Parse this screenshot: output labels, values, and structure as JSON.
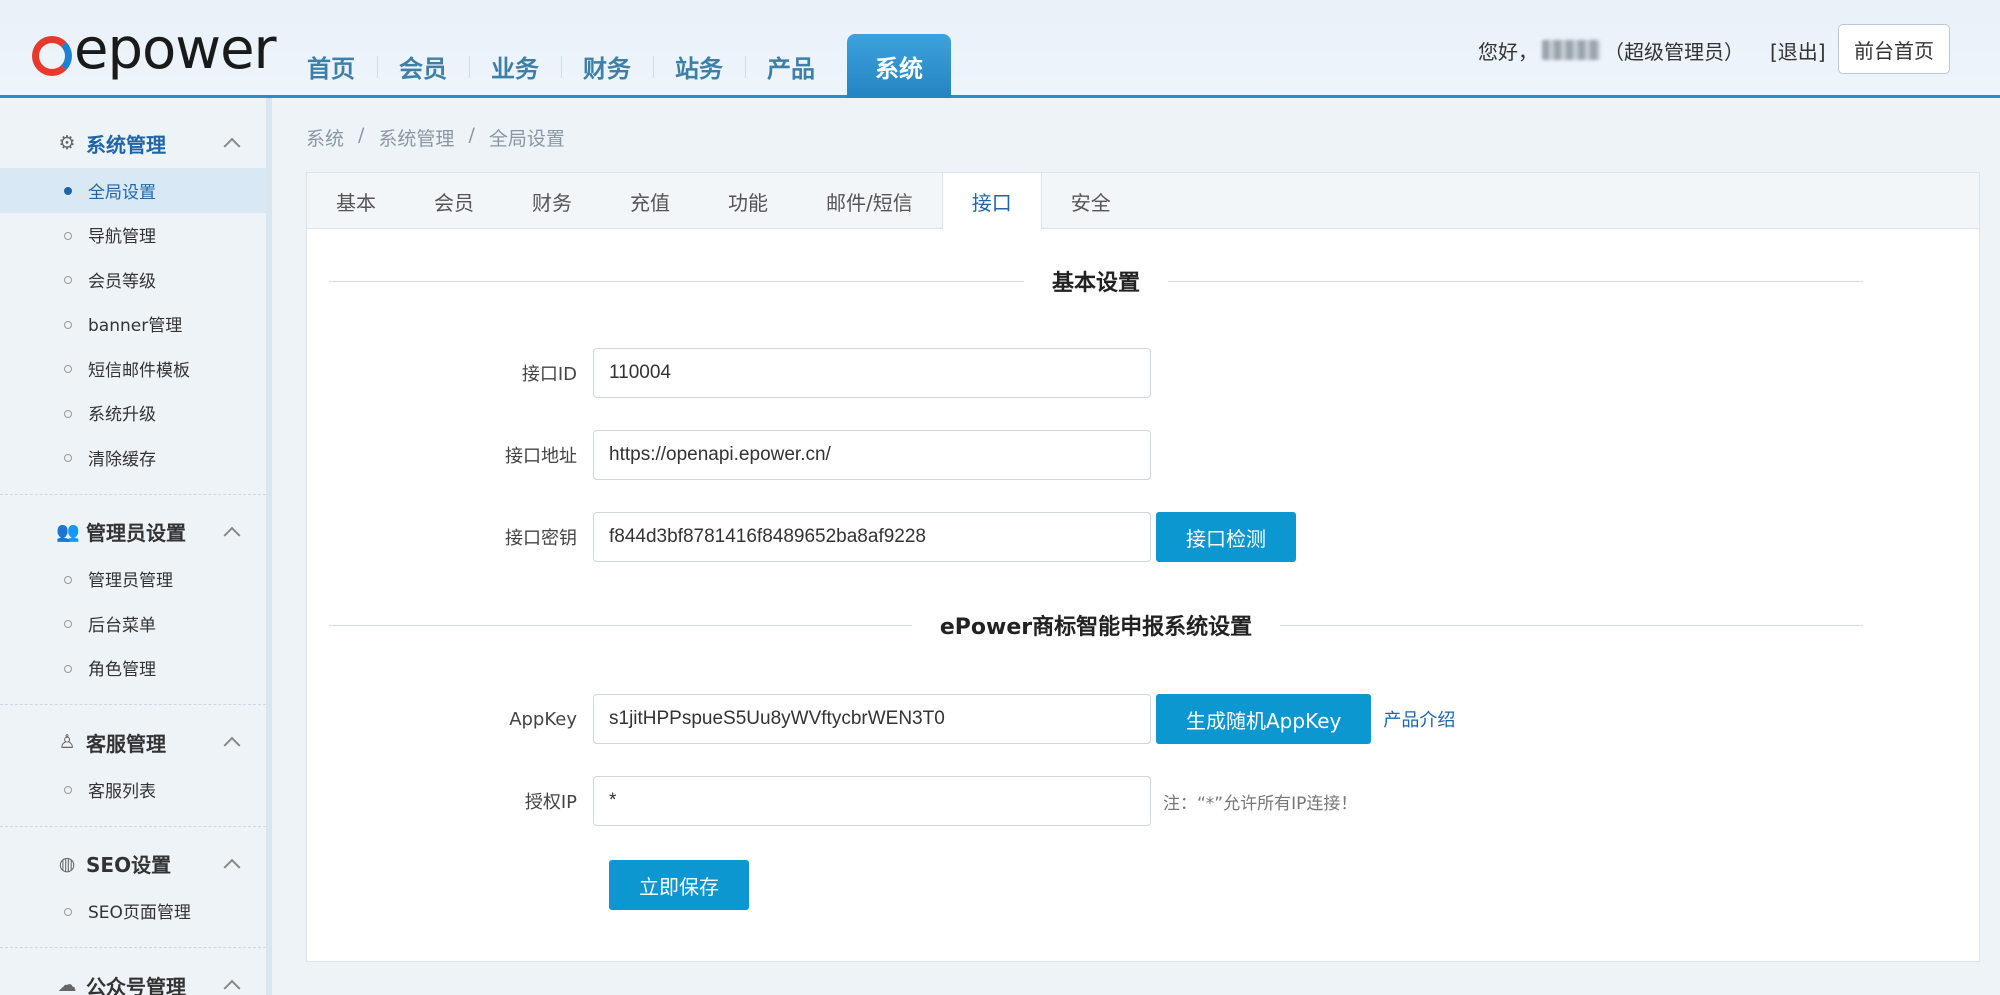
{
  "logo": {
    "text": "epower"
  },
  "nav": {
    "items": [
      "首页",
      "会员",
      "业务",
      "财务",
      "站务",
      "产品",
      "系统"
    ],
    "active": "系统"
  },
  "user": {
    "greeting": "您好，",
    "role": "（超级管理员）",
    "logout": "[退出]",
    "front_home": "前台首页"
  },
  "sidebar": {
    "groups": [
      {
        "title": "系统管理",
        "icon": "gears-icon",
        "items": [
          "全局设置",
          "导航管理",
          "会员等级",
          "banner管理",
          "短信邮件模板",
          "系统升级",
          "清除缓存"
        ]
      },
      {
        "title": "管理员设置",
        "icon": "users-icon",
        "items": [
          "管理员管理",
          "后台菜单",
          "角色管理"
        ]
      },
      {
        "title": "客服管理",
        "icon": "support-icon",
        "items": [
          "客服列表"
        ]
      },
      {
        "title": "SEO设置",
        "icon": "globe-icon",
        "items": [
          "SEO页面管理"
        ]
      },
      {
        "title": "公众号管理",
        "icon": "wechat-icon",
        "items": []
      }
    ],
    "active_item": "全局设置"
  },
  "breadcrumb": [
    "系统",
    "/",
    "系统管理",
    "/",
    "全局设置"
  ],
  "tabs": [
    "基本",
    "会员",
    "财务",
    "充值",
    "功能",
    "邮件/短信",
    "接口",
    "安全"
  ],
  "active_tab": "接口",
  "form": {
    "section1_title": "基本设置",
    "api_id_label": "接口ID",
    "api_id_value": "110004",
    "api_url_label": "接口地址",
    "api_url_value": "https://openapi.epower.cn/",
    "api_secret_label": "接口密钥",
    "api_secret_value": "f844d3bf8781416f8489652ba8af9228",
    "check_button": "接口检测",
    "section2_title": "ePower商标智能申报系统设置",
    "appkey_label": "AppKey",
    "appkey_value": "s1jitHPPspueS5Uu8yWVftycbrWEN3T0",
    "generate_button": "生成随机AppKey",
    "product_link": "产品介绍",
    "ip_label": "授权IP",
    "ip_value": "*",
    "ip_note": "注：“*”允许所有IP连接！",
    "save_button": "立即保存"
  }
}
